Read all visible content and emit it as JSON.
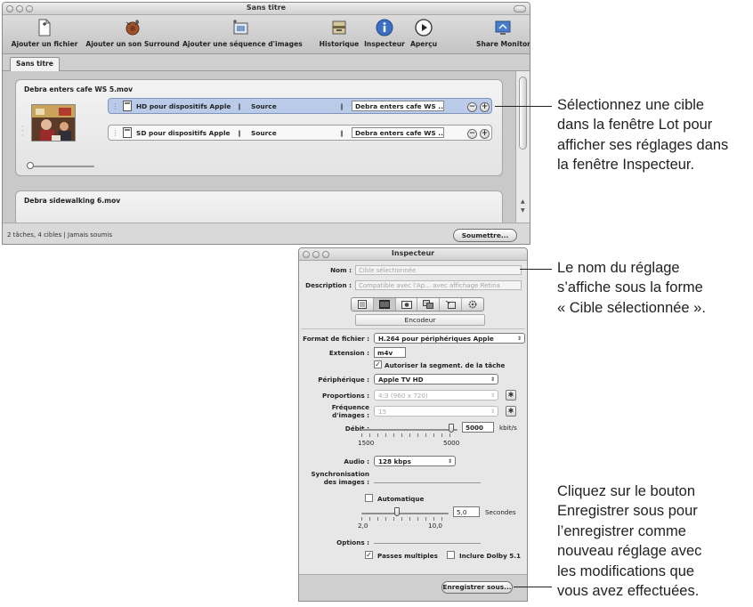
{
  "batch_window": {
    "title": "Sans titre",
    "toolbar": {
      "add_file": "Ajouter un fichier",
      "add_surround": "Ajouter un son Surround",
      "add_image_sequence": "Ajouter une séquence d'images",
      "history": "Historique",
      "inspector": "Inspecteur",
      "preview": "Aperçu",
      "share_monitor": "Share Monitor"
    },
    "tab": "Sans titre",
    "groups": [
      {
        "title": "Debra enters cafe WS 5.mov",
        "targets": [
          {
            "setting": "HD pour dispositifs Apple",
            "destination": "Source",
            "output": "Debra enters cafe WS ...",
            "selected": true
          },
          {
            "setting": "SD pour dispositifs Apple",
            "destination": "Source",
            "output": "Debra enters cafe WS ...",
            "selected": false
          }
        ]
      },
      {
        "title": "Debra sidewalking 6.mov"
      }
    ],
    "status": "2 tâches, 4 cibles  |  Jamais soumis",
    "submit": "Soumettre..."
  },
  "inspector": {
    "title": "Inspecteur",
    "name_label": "Nom :",
    "name_value": "Cible sélectionnée",
    "description_label": "Description :",
    "description_value": "Compatible avec l'Ap... avec affichage Retina",
    "encoder_tab": "Encodeur",
    "file_format_label": "Format de fichier :",
    "file_format_value": "H.264 pour périphériques Apple",
    "extension_label": "Extension :",
    "extension_value": "m4v",
    "allow_segment": "Autoriser la segment. de la tâche",
    "device_label": "Périphérique :",
    "device_value": "Apple TV HD",
    "aspect_label": "Proportions :",
    "aspect_value": "4:3 (960 x 720)",
    "frame_rate_label_1": "Fréquence",
    "frame_rate_label_2": "d'images :",
    "frame_rate_value": "15",
    "bitrate_label": "Débit :",
    "bitrate_min": "1500",
    "bitrate_max": "5000",
    "bitrate_value": "5000",
    "bitrate_unit": "kbit/s",
    "audio_label": "Audio :",
    "audio_value": "128 kbps",
    "sync_label_1": "Synchronisation",
    "sync_label_2": "des images :",
    "automatic": "Automatique",
    "seconds_value": "5,0",
    "seconds_unit": "Secondes",
    "seconds_min": "2,0",
    "seconds_max": "10,0",
    "options_label": "Options :",
    "multipass": "Passes multiples",
    "dolby": "Inclure Dolby 5.1",
    "save_as": "Enregistrer sous..."
  },
  "callouts": {
    "select_target": [
      "Sélectionnez une cible",
      "dans la fenêtre Lot pour",
      "afficher ses réglages dans",
      "la fenêtre Inspecteur."
    ],
    "setting_name": [
      "Le nom du réglage",
      "s’affiche sous la forme",
      "« Cible sélectionnée »."
    ],
    "save_as": [
      "Cliquez sur le bouton",
      "Enregistrer sous pour",
      "l’enregistrer comme",
      "nouveau réglage avec",
      "les modifications que",
      "vous avez effectuées."
    ]
  },
  "colors": {
    "selection": "#b9cbe9",
    "accent_blue": "#3b6fc4"
  }
}
